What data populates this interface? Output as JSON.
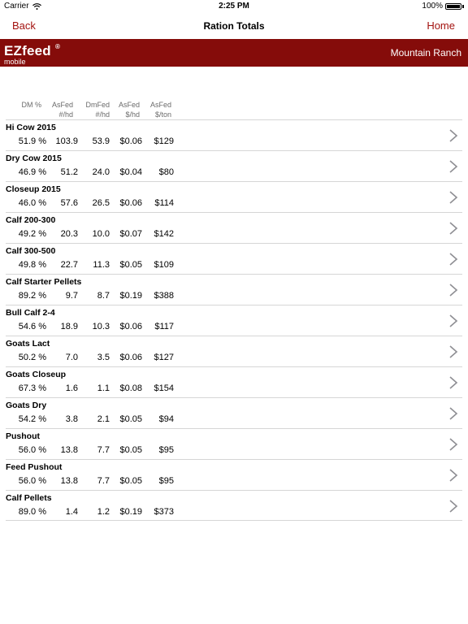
{
  "status": {
    "carrier": "Carrier",
    "time": "2:25 PM",
    "battery": "100%"
  },
  "nav": {
    "back": "Back",
    "title": "Ration Totals",
    "home": "Home"
  },
  "brand": {
    "name": "EZfeed",
    "registered": "®",
    "subtitle": "mobile",
    "ranch": "Mountain Ranch"
  },
  "columns": [
    {
      "line1": "",
      "line2": "DM %"
    },
    {
      "line1": "AsFed",
      "line2": "#/hd"
    },
    {
      "line1": "DmFed",
      "line2": "#/hd"
    },
    {
      "line1": "AsFed",
      "line2": "$/hd"
    },
    {
      "line1": "AsFed",
      "line2": "$/ton"
    }
  ],
  "rations": [
    {
      "name": "Hi Cow 2015",
      "dm": "51.9 %",
      "asfed": "103.9",
      "dmfed": "53.9",
      "cost_hd": "$0.06",
      "cost_ton": "$129"
    },
    {
      "name": "Dry Cow 2015",
      "dm": "46.9 %",
      "asfed": "51.2",
      "dmfed": "24.0",
      "cost_hd": "$0.04",
      "cost_ton": "$80"
    },
    {
      "name": "Closeup 2015",
      "dm": "46.0 %",
      "asfed": "57.6",
      "dmfed": "26.5",
      "cost_hd": "$0.06",
      "cost_ton": "$114"
    },
    {
      "name": "Calf 200-300",
      "dm": "49.2 %",
      "asfed": "20.3",
      "dmfed": "10.0",
      "cost_hd": "$0.07",
      "cost_ton": "$142"
    },
    {
      "name": "Calf 300-500",
      "dm": "49.8 %",
      "asfed": "22.7",
      "dmfed": "11.3",
      "cost_hd": "$0.05",
      "cost_ton": "$109"
    },
    {
      "name": "Calf Starter Pellets",
      "dm": "89.2 %",
      "asfed": "9.7",
      "dmfed": "8.7",
      "cost_hd": "$0.19",
      "cost_ton": "$388"
    },
    {
      "name": "Bull Calf 2-4",
      "dm": "54.6 %",
      "asfed": "18.9",
      "dmfed": "10.3",
      "cost_hd": "$0.06",
      "cost_ton": "$117"
    },
    {
      "name": "Goats Lact",
      "dm": "50.2 %",
      "asfed": "7.0",
      "dmfed": "3.5",
      "cost_hd": "$0.06",
      "cost_ton": "$127"
    },
    {
      "name": "Goats Closeup",
      "dm": "67.3 %",
      "asfed": "1.6",
      "dmfed": "1.1",
      "cost_hd": "$0.08",
      "cost_ton": "$154"
    },
    {
      "name": "Goats Dry",
      "dm": "54.2 %",
      "asfed": "3.8",
      "dmfed": "2.1",
      "cost_hd": "$0.05",
      "cost_ton": "$94"
    },
    {
      "name": "Pushout",
      "dm": "56.0 %",
      "asfed": "13.8",
      "dmfed": "7.7",
      "cost_hd": "$0.05",
      "cost_ton": "$95"
    },
    {
      "name": "Feed Pushout",
      "dm": "56.0 %",
      "asfed": "13.8",
      "dmfed": "7.7",
      "cost_hd": "$0.05",
      "cost_ton": "$95"
    },
    {
      "name": "Calf Pellets",
      "dm": "89.0 %",
      "asfed": "1.4",
      "dmfed": "1.2",
      "cost_hd": "$0.19",
      "cost_ton": "$373"
    }
  ],
  "icons": {
    "wifi": "wifi-icon",
    "battery": "battery-icon",
    "chevron": "chevron-right-icon"
  },
  "colors": {
    "accent": "#a3120f",
    "brand_bar": "#850c0a",
    "header_text": "#6b6b6b",
    "chevron": "#8e8e93"
  }
}
